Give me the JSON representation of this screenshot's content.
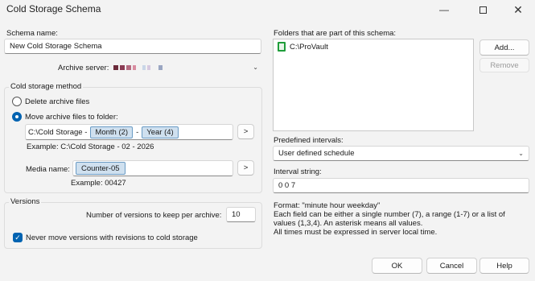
{
  "window": {
    "title": "Cold Storage Schema",
    "minimize_icon": "minimize-icon",
    "maximize_icon": "maximize-icon",
    "close_icon": "close-icon"
  },
  "schema_name": {
    "label": "Schema name:",
    "value": "New Cold Storage Schema"
  },
  "archive_server": {
    "label": "Archive server:"
  },
  "cold_storage_method": {
    "title": "Cold storage method",
    "delete_label": "Delete archive files",
    "move_label": "Move archive files to folder:",
    "selected": "move",
    "folder_prefix": "C:\\Cold Storage -",
    "token_month": "Month (2)",
    "separator": "-",
    "token_year": "Year (4)",
    "folder_example": "Example: C:\\Cold Storage - 02 - 2026",
    "browse_label": ">",
    "media_label": "Media name:",
    "media_token": "Counter-05",
    "media_example": "Example: 00427"
  },
  "versions": {
    "title": "Versions",
    "keep_label": "Number of versions to keep per archive:",
    "keep_value": "10",
    "never_move_label": "Never move versions with revisions to cold storage",
    "never_move_checked": true
  },
  "folders": {
    "label": "Folders that are part of this schema:",
    "items": [
      {
        "name": "C:\\ProVault",
        "icon": "folder-icon"
      }
    ],
    "add_label": "Add...",
    "remove_label": "Remove"
  },
  "predefined": {
    "label": "Predefined intervals:",
    "value": "User defined schedule"
  },
  "interval": {
    "label": "Interval string:",
    "value": "0 0 7"
  },
  "format_help": {
    "line1": "Format: \"minute hour weekday\"",
    "line2": "Each field can be either a single number (7), a range (1-7) or a list of",
    "line3": "values (1,3,4). An asterisk means all values.",
    "line4": "All times must be expressed in server local time."
  },
  "buttons": {
    "ok": "OK",
    "cancel": "Cancel",
    "help": "Help"
  },
  "colors": {
    "accent": "#0063b1",
    "token_bg": "#cfe0ef",
    "folder_green": "#1f9d3a"
  }
}
